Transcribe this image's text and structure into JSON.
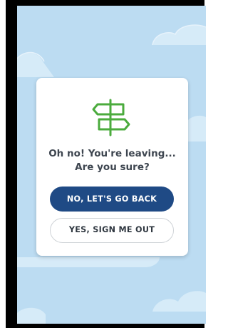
{
  "dialog": {
    "line1": "Oh no! You're leaving...",
    "line2": "Are you sure?",
    "primary_label": "NO, LET'S GO BACK",
    "secondary_label": "YES, SIGN ME OUT",
    "icon": "signpost-icon"
  },
  "colors": {
    "background": "#bcdcf2",
    "cloud": "#d6ebf8",
    "accent_green": "#4bab3d",
    "primary_button": "#1f4a85",
    "title_text": "#3e4650"
  }
}
